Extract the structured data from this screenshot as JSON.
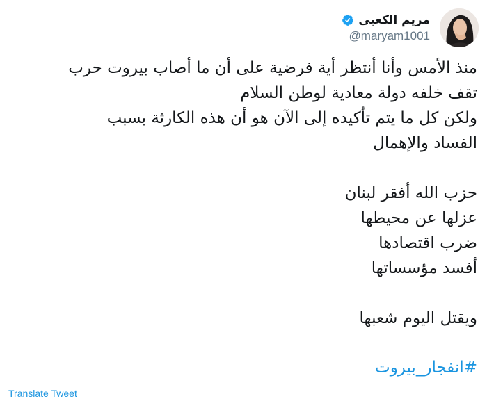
{
  "author": {
    "display_name": "مريم الكعبى",
    "handle": "@maryam1001",
    "verified_icon": "verified-badge-icon",
    "avatar": "profile-avatar"
  },
  "tweet": {
    "lines": [
      "منذ الأمس وأنا أنتظر أية فرضية على أن ما أصاب بيروت حرب",
      "تقف خلفه دولة معادية لوطن السلام",
      "ولكن كل ما يتم تأكيده إلى الآن هو أن هذه الكارثة بسبب",
      "الفساد والإهمال",
      "",
      "حزب الله أفقر لبنان",
      "عزلها عن محيطها",
      "ضرب اقتصادها",
      "أفسد مؤسساتها",
      "",
      "ويقتل اليوم شعبها"
    ],
    "hashtag": "#انفجار_بيروت"
  },
  "actions": {
    "translate_label": "Translate Tweet"
  },
  "colors": {
    "link": "#1b95e0",
    "handle": "#657786",
    "text": "#14171a",
    "verified": "#1da1f2"
  }
}
